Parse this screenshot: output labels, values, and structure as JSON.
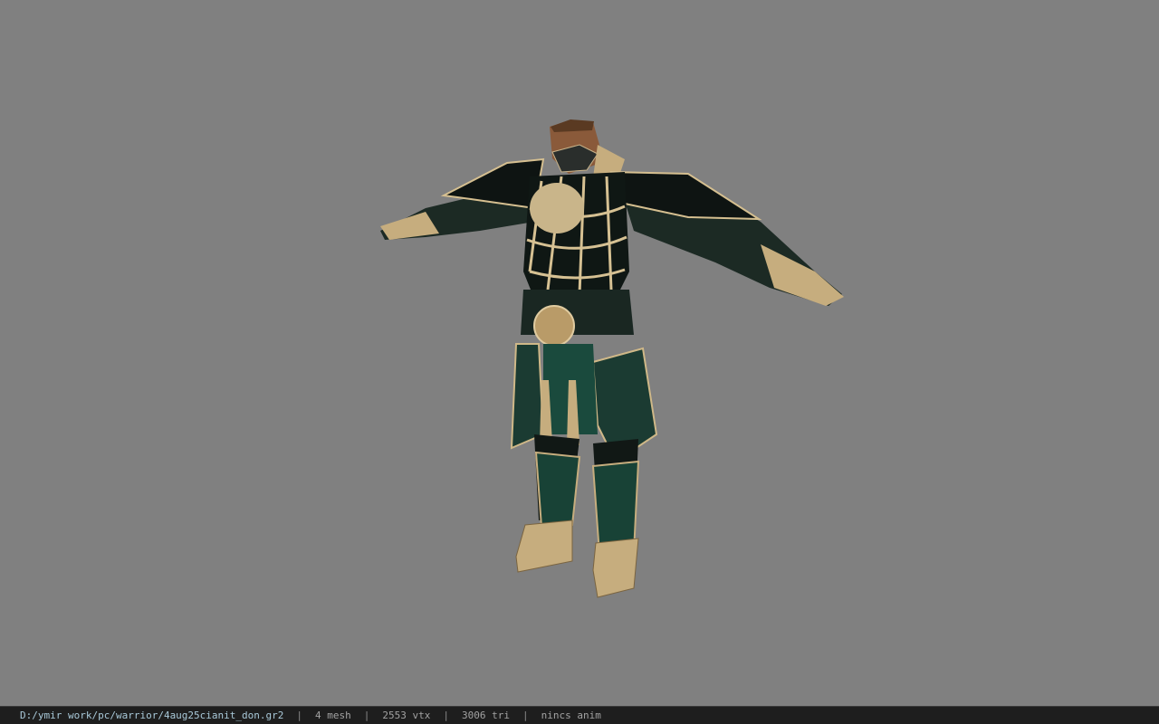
{
  "viewer": {
    "background_color": "#808080",
    "model_icon": "armored-warrior-model-icon"
  },
  "status_bar": {
    "file_path": "D:/ymir work/pc/warrior/4aug25cianit_don.gr2",
    "separator": "|",
    "mesh_count": "4 mesh",
    "vertex_count": "2553 vtx",
    "triangle_count": "3006 tri",
    "animation": "nincs anim"
  }
}
